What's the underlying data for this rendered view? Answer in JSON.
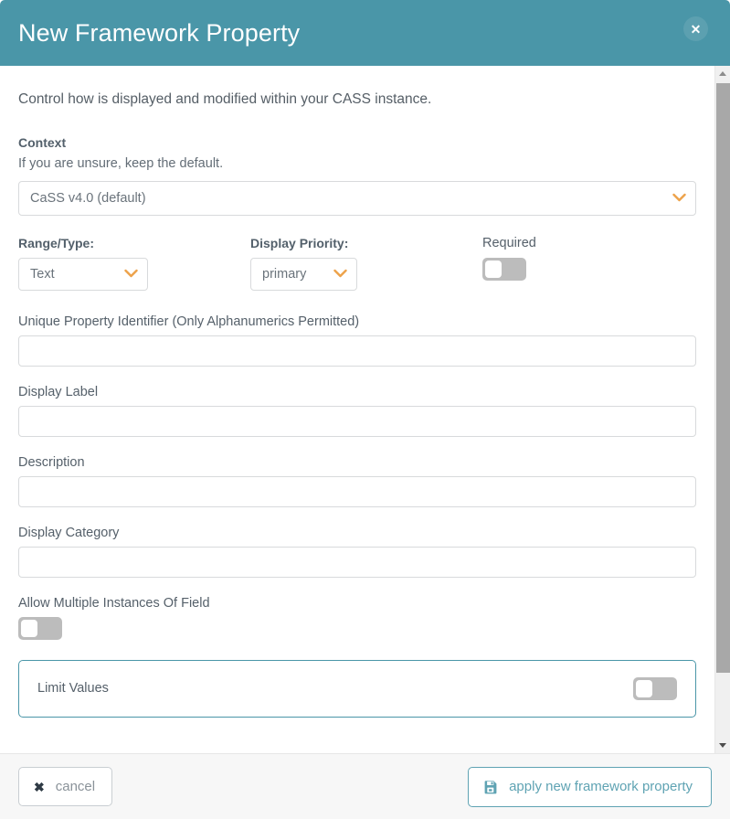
{
  "header": {
    "title": "New Framework Property",
    "close_label": "✕",
    "bg_color": "#4a96a8"
  },
  "body": {
    "intro": "Control how is displayed and modified within your CASS instance.",
    "context": {
      "label": "Context",
      "helper": "If you are unsure, keep the default.",
      "selected": "CaSS v4.0 (default)"
    },
    "range_type": {
      "label": "Range/Type:",
      "selected": "Text"
    },
    "display_priority": {
      "label": "Display Priority:",
      "selected": "primary"
    },
    "required": {
      "label": "Required",
      "state": "off"
    },
    "unique_property_identifier": {
      "label": "Unique Property Identifier (Only Alphanumerics Permitted)",
      "value": "",
      "placeholder": ""
    },
    "display_label": {
      "label": "Display Label",
      "value": "",
      "placeholder": ""
    },
    "description": {
      "label": "Description",
      "value": "",
      "placeholder": ""
    },
    "display_category": {
      "label": "Display Category",
      "value": "",
      "placeholder": ""
    },
    "allow_multiple": {
      "label": "Allow Multiple Instances Of Field",
      "state": "off"
    },
    "limit_values": {
      "label": "Limit Values",
      "state": "off",
      "border_color": "#4a96a8"
    }
  },
  "footer": {
    "cancel_label": "cancel",
    "cancel_icon": "✖",
    "apply_label": "apply new framework property",
    "apply_accent": "#5fa3b3"
  },
  "scrollbar": {
    "up_arrow": "▲",
    "down_arrow": "▼"
  }
}
